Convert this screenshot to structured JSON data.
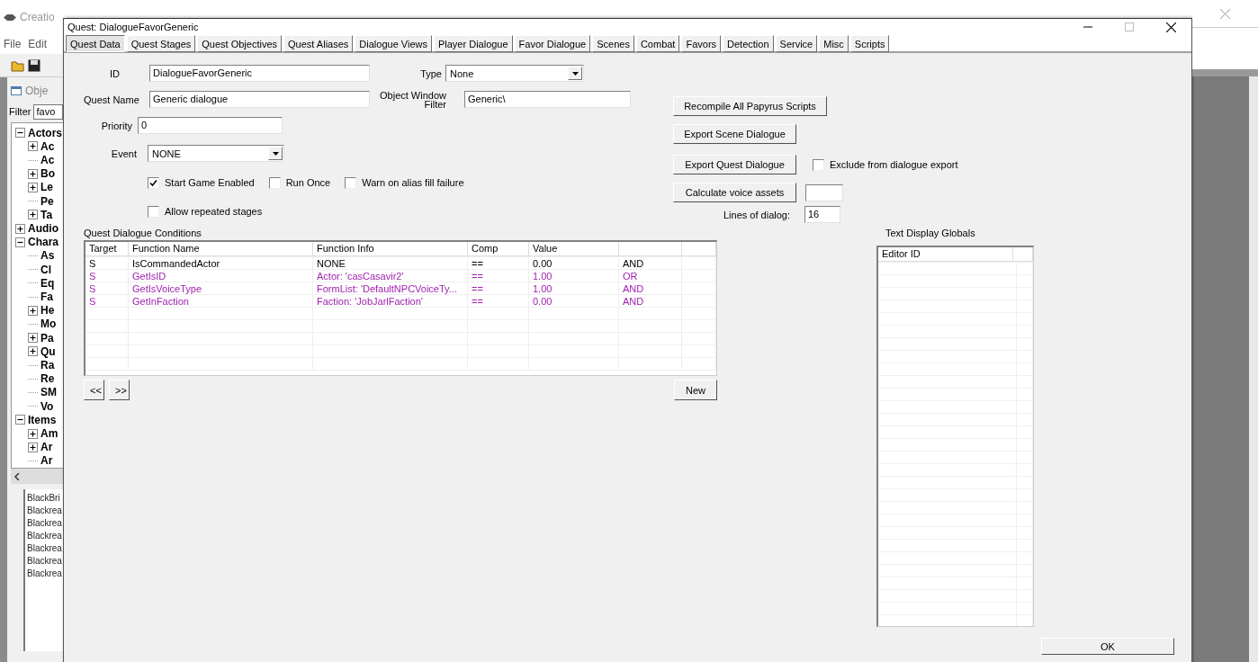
{
  "background_app": {
    "title": "Creatio",
    "menu": [
      "File",
      "Edit"
    ],
    "object_window": {
      "title": "Obje",
      "filter_label": "Filter",
      "filter_value": "favo",
      "tree": [
        {
          "label": "Actors",
          "kind": "group",
          "expanded": true,
          "children": [
            {
              "label": "Ac",
              "kind": "group",
              "expanded": false
            },
            {
              "label": "Ac",
              "kind": "leaf"
            },
            {
              "label": "Bo",
              "kind": "group",
              "expanded": false
            },
            {
              "label": "Le",
              "kind": "group",
              "expanded": false
            },
            {
              "label": "Pe",
              "kind": "leaf"
            },
            {
              "label": "Ta",
              "kind": "group",
              "expanded": false
            }
          ]
        },
        {
          "label": "Audio",
          "kind": "group",
          "expanded": false
        },
        {
          "label": "Chara",
          "kind": "group",
          "expanded": true,
          "children": [
            {
              "label": "As",
              "kind": "leaf"
            },
            {
              "label": "Cl",
              "kind": "leaf"
            },
            {
              "label": "Eq",
              "kind": "leaf"
            },
            {
              "label": "Fa",
              "kind": "leaf"
            },
            {
              "label": "He",
              "kind": "group",
              "expanded": false
            },
            {
              "label": "Mo",
              "kind": "leaf"
            },
            {
              "label": "Pa",
              "kind": "group",
              "expanded": false
            },
            {
              "label": "Qu",
              "kind": "group",
              "expanded": false
            },
            {
              "label": "Ra",
              "kind": "leaf"
            },
            {
              "label": "Re",
              "kind": "leaf"
            },
            {
              "label": "SM",
              "kind": "leaf"
            },
            {
              "label": "Vo",
              "kind": "leaf"
            }
          ]
        },
        {
          "label": "Items",
          "kind": "group",
          "expanded": true,
          "children": [
            {
              "label": "Am",
              "kind": "group",
              "expanded": false
            },
            {
              "label": "Ar",
              "kind": "group",
              "expanded": false
            },
            {
              "label": "Ar",
              "kind": "leaf"
            }
          ]
        }
      ],
      "list": [
        "BlackBri",
        "Blackrea",
        "Blackrea",
        "Blackrea",
        "Blackrea",
        "Blackrea",
        "Blackrea"
      ]
    }
  },
  "dialog": {
    "title": "Quest: DialogueFavorGeneric",
    "tabs": [
      {
        "label": "Quest Data",
        "selected": true
      },
      {
        "label": "Quest Stages",
        "selected": false
      },
      {
        "label": "Quest Objectives",
        "selected": false
      },
      {
        "label": "Quest Aliases",
        "selected": false
      },
      {
        "label": "Dialogue Views",
        "selected": false
      },
      {
        "label": "Player Dialogue",
        "selected": false
      },
      {
        "label": "Favor Dialogue",
        "selected": false
      },
      {
        "label": "Scenes",
        "selected": false
      },
      {
        "label": "Combat",
        "selected": false
      },
      {
        "label": "Favors",
        "selected": false
      },
      {
        "label": "Detection",
        "selected": false
      },
      {
        "label": "Service",
        "selected": false
      },
      {
        "label": "Misc",
        "selected": false
      },
      {
        "label": "Scripts",
        "selected": false
      }
    ],
    "form": {
      "id": {
        "label": "ID",
        "value": "DialogueFavorGeneric"
      },
      "type": {
        "label": "Type",
        "value": "None"
      },
      "quest_name": {
        "label": "Quest Name",
        "value": "Generic dialogue"
      },
      "object_window_filter": {
        "label": "Object Window Filter",
        "value": "Generic\\"
      },
      "priority": {
        "label": "Priority",
        "value": "0"
      },
      "event": {
        "label": "Event",
        "value": "NONE"
      },
      "checkboxes": [
        {
          "label": "Start Game Enabled",
          "checked": true
        },
        {
          "label": "Run Once",
          "checked": false
        },
        {
          "label": "Warn on alias fill failure",
          "checked": false
        }
      ],
      "allow_repeated_stages": {
        "label": "Allow repeated stages",
        "checked": false
      }
    },
    "actions": {
      "recompile": "Recompile All Papyrus Scripts",
      "export_scene": "Export Scene Dialogue",
      "export_quest": "Export Quest Dialogue",
      "exclude": {
        "label": "Exclude from dialogue export",
        "checked": false
      },
      "calculate": "Calculate voice assets",
      "lines_of_dialog": {
        "label": "Lines of dialog:",
        "value": "16"
      }
    },
    "conditions": {
      "title": "Quest Dialogue Conditions",
      "columns": [
        "Target",
        "Function Name",
        "Function Info",
        "Comp",
        "Value"
      ],
      "rows": [
        {
          "target": "S",
          "function_name": "IsCommandedActor",
          "function_info": "NONE",
          "comp": "==",
          "value": "0.00",
          "column_6": "AND",
          "color": "#000000"
        },
        {
          "target": "S",
          "function_name": "GetIsID",
          "function_info": "Actor: 'casCasavir2'",
          "comp": "==",
          "value": "1.00",
          "column_6": "OR",
          "color": "#a01fb0"
        },
        {
          "target": "S",
          "function_name": "GetIsVoiceType",
          "function_info": "FormList: 'DefaultNPCVoiceTy...",
          "comp": "==",
          "value": "1.00",
          "column_6": "AND",
          "color": "#a01fb0"
        },
        {
          "target": "S",
          "function_name": "GetInFaction",
          "function_info": "Faction: 'JobJarlFaction'",
          "comp": "==",
          "value": "0.00",
          "column_6": "AND",
          "color": "#a01fb0"
        }
      ],
      "prev": "<<",
      "next": ">>",
      "new": "New"
    },
    "text_display_globals": {
      "title": "Text Display Globals",
      "columns": [
        "Editor ID"
      ]
    },
    "ok": "OK"
  }
}
